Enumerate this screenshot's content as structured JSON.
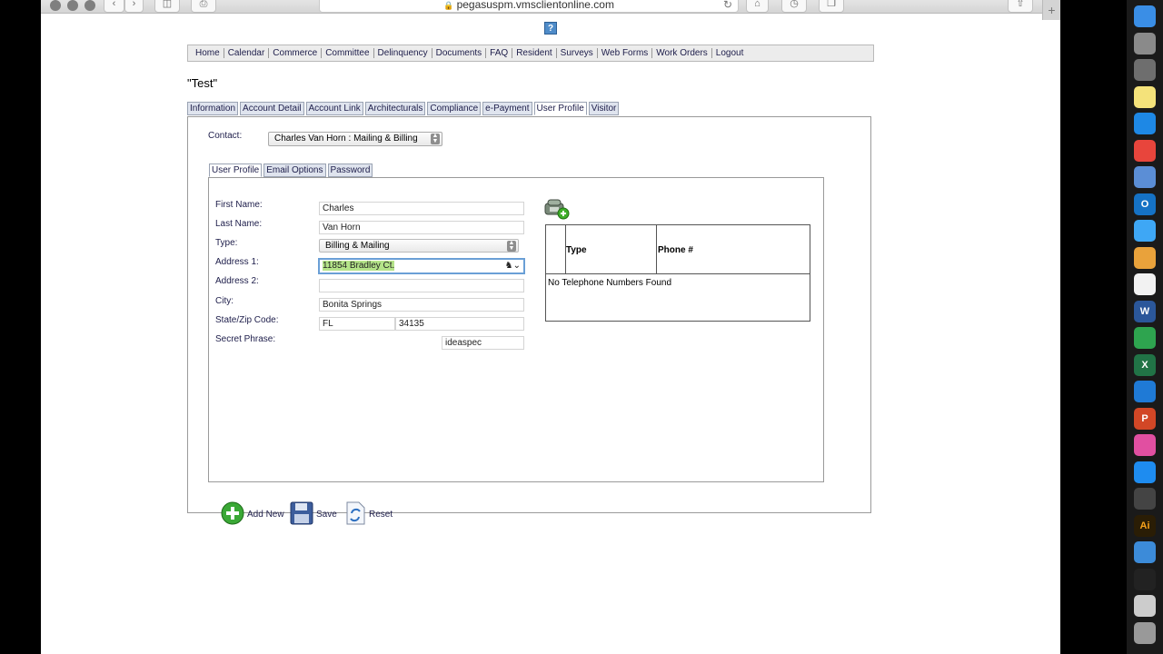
{
  "browser": {
    "url": "pegasuspm.vmsclientonline.com",
    "new_tab_glyph": "+"
  },
  "help_glyph": "?",
  "nav": [
    "Home",
    "Calendar",
    "Commerce",
    "Committee",
    "Delinquency",
    "Documents",
    "FAQ",
    "Resident",
    "Surveys",
    "Web Forms",
    "Work Orders",
    "Logout"
  ],
  "page_title": "\"Test\"",
  "outer_tabs": [
    {
      "label": "Information",
      "active": false
    },
    {
      "label": "Account Detail",
      "active": false
    },
    {
      "label": "Account Link",
      "active": false
    },
    {
      "label": "Architecturals",
      "active": false
    },
    {
      "label": "Compliance",
      "active": false
    },
    {
      "label": "e-Payment",
      "active": false
    },
    {
      "label": "User Profile",
      "active": true
    },
    {
      "label": "Visitor",
      "active": false
    }
  ],
  "contact": {
    "label": "Contact:",
    "selected": "Charles Van Horn : Mailing & Billing"
  },
  "inner_tabs": [
    {
      "label": "User Profile",
      "active": true
    },
    {
      "label": "Email Options",
      "active": false
    },
    {
      "label": "Password",
      "active": false
    }
  ],
  "form": {
    "first_name": {
      "label": "First Name:",
      "value": "Charles"
    },
    "last_name": {
      "label": "Last Name:",
      "value": "Van Horn"
    },
    "type": {
      "label": "Type:",
      "value": "Billing & Mailing"
    },
    "address1": {
      "label": "Address 1:",
      "value": "11854 Bradley Ct."
    },
    "address2": {
      "label": "Address 2:",
      "value": ""
    },
    "city": {
      "label": "City:",
      "value": "Bonita Springs"
    },
    "state_zip": {
      "label": "State/Zip Code:",
      "state": "FL",
      "zip": "34135"
    },
    "secret": {
      "label": "Secret Phrase:",
      "value": "ideaspec"
    }
  },
  "phones": {
    "headers": [
      "Type",
      "Phone #"
    ],
    "empty_message": "No Telephone Numbers Found"
  },
  "actions": {
    "add_new": "Add New",
    "save": "Save",
    "reset": "Reset"
  },
  "colors": {
    "link_text": "#1d1d4a",
    "tab_bg": "#dfe4ee",
    "selection_highlight": "#b4e389",
    "focus_ring": "#6a9fd6"
  },
  "dock_icons": [
    "finder-icon",
    "launchpad-icon",
    "system-preferences-icon",
    "notes-icon",
    "safari-icon",
    "chrome-icon",
    "preview-icon",
    "outlook-icon",
    "messages-icon",
    "photos-icon",
    "textedit-icon",
    "word-icon",
    "numbers-icon",
    "excel-icon",
    "keynote-icon",
    "powerpoint-icon",
    "itunes-icon",
    "app-store-icon",
    "final-cut-icon",
    "illustrator-icon",
    "things-icon",
    "quicktime-icon",
    "downloads-icon",
    "trash-icon"
  ],
  "dock_glyphs": {
    "outlook": "O",
    "word": "W",
    "excel": "X",
    "powerpoint": "P",
    "illustrator": "Ai"
  }
}
